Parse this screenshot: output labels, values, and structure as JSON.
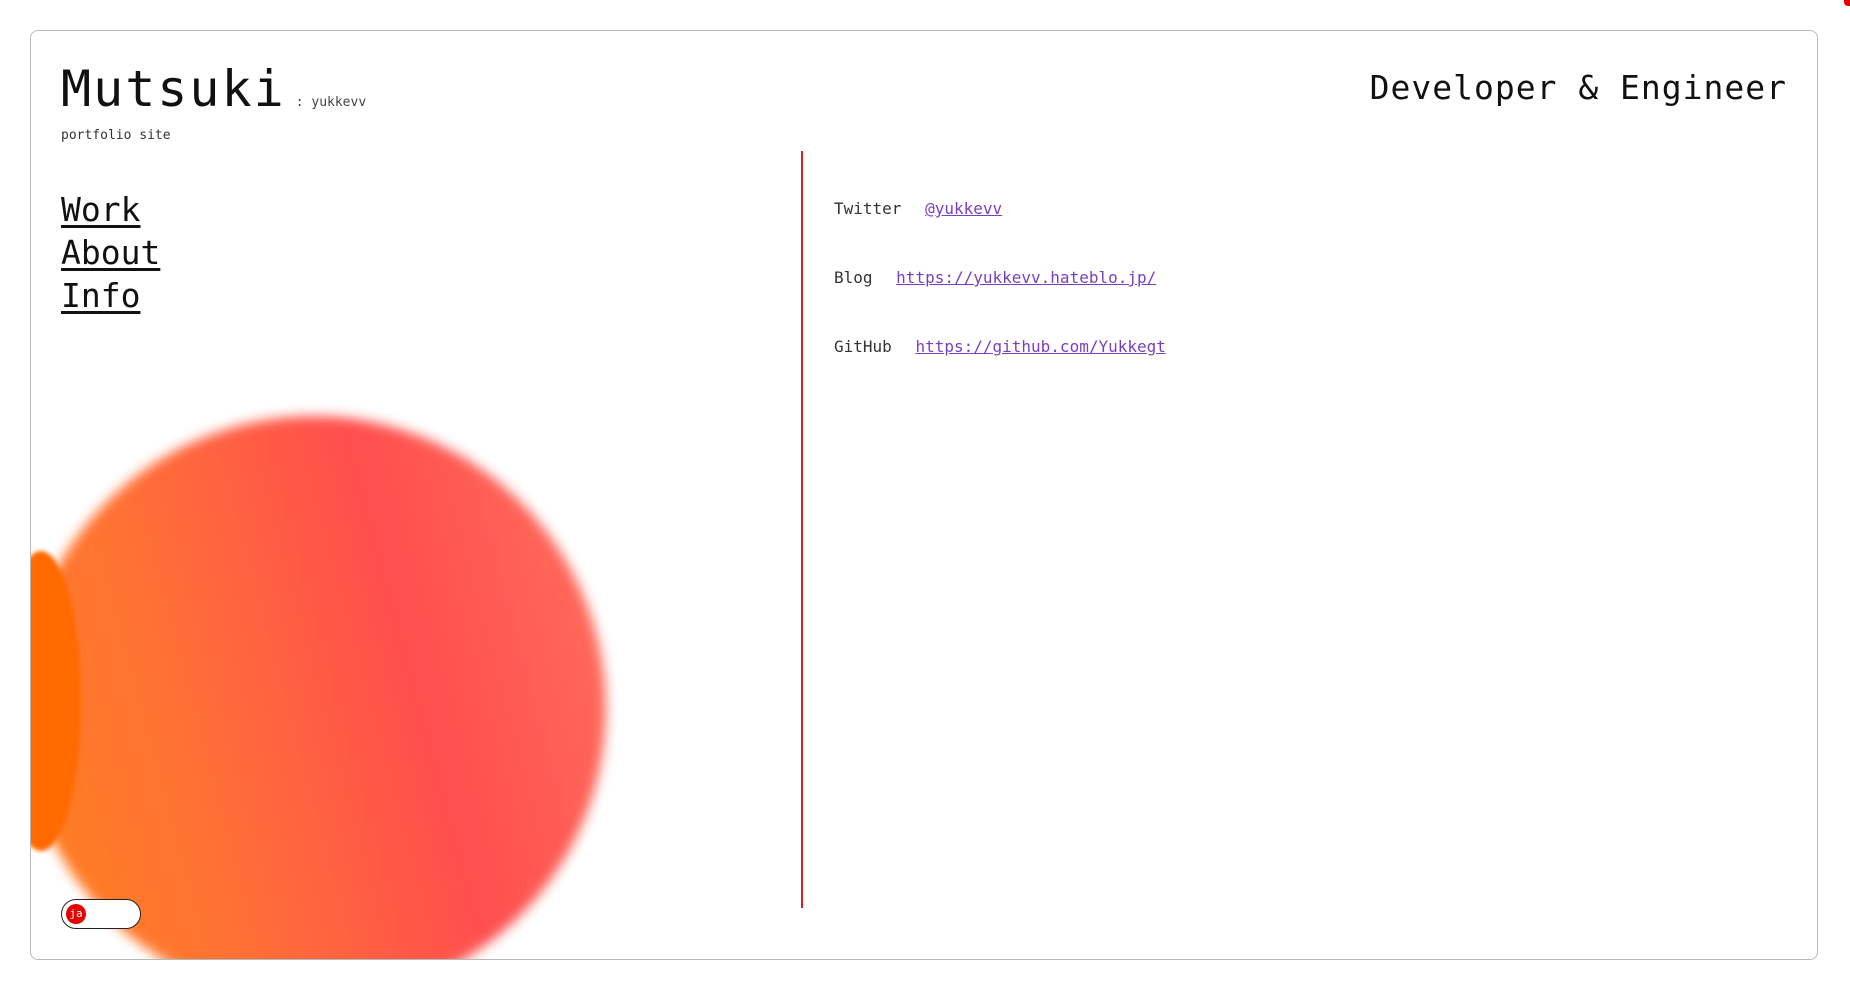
{
  "header": {
    "title": "Mutsuki",
    "handle": ": yukkevv",
    "subtitle": "portfolio site",
    "role": "Developer & Engineer"
  },
  "nav": {
    "items": [
      {
        "label": "Work"
      },
      {
        "label": "About"
      },
      {
        "label": "Info"
      }
    ]
  },
  "info": {
    "twitter": {
      "label": "Twitter",
      "value": "@yukkevv"
    },
    "blog": {
      "label": "Blog",
      "value": "https://yukkevv.hateblo.jp/"
    },
    "github": {
      "label": "GitHub",
      "value": "https://github.com/Yukkegt"
    }
  },
  "lang_toggle": {
    "value": "ja"
  },
  "colors": {
    "accent": "#d42020",
    "link": "#7a3fbf",
    "blob_orange": "#ff7a10",
    "blob_red": "#ff4545"
  }
}
